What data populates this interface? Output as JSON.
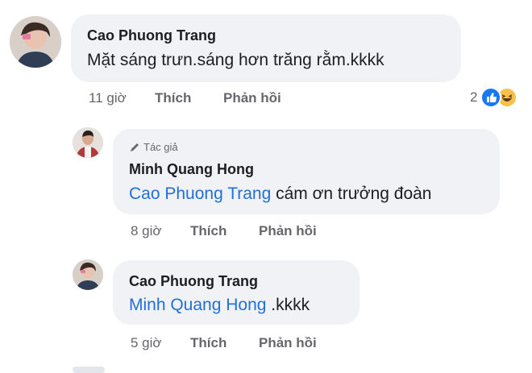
{
  "comments": [
    {
      "author": "Cao Phuong Trang",
      "text": "Mặt sáng trưn.sáng hơn trăng rằm.kkkk",
      "time": "11 giờ",
      "like_label": "Thích",
      "reply_label": "Phản hồi",
      "reaction_count": "2",
      "reaction_icons": [
        "like-icon",
        "haha-icon"
      ]
    },
    {
      "badge": "Tác giả",
      "badge_icon": "pencil-icon",
      "author": "Minh Quang Hong",
      "mention": "Cao Phuong Trang",
      "text": " cám ơn trưởng đoàn",
      "time": "8 giờ",
      "like_label": "Thích",
      "reply_label": "Phản hồi"
    },
    {
      "author": "Cao Phuong Trang",
      "mention": "Minh Quang Hong",
      "text": " .kkkk",
      "time": "5 giờ",
      "like_label": "Thích",
      "reply_label": "Phản hồi"
    }
  ],
  "colors": {
    "bubble": "#f0f2f5",
    "mention": "#216fdb",
    "meta": "#65676b",
    "like": "#1877f2",
    "haha": "#f7c14a"
  }
}
